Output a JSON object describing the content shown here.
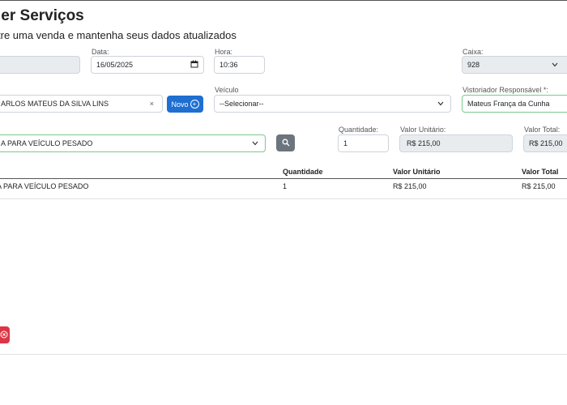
{
  "header": {
    "title": "ler Serviços",
    "subtitle": "tre uma venda e mantenha seus dados atualizados"
  },
  "form": {
    "data_label": "Data:",
    "data_value": "16/05/2025",
    "hora_label": "Hora:",
    "hora_value": "10:36",
    "caixa_label": "Caixa:",
    "caixa_value": "928",
    "cliente_value": "ARLOS MATEUS DA SILVA LINS",
    "novo_label": "Novo",
    "veiculo_label": "Veículo",
    "veiculo_value": "--Selecionar--",
    "vistoriador_label": "Vistoriador Responsável *:",
    "vistoriador_value": "Mateus França da Cunha",
    "servico_value": "A PARA VEÍCULO PESADO",
    "quantidade_label": "Quantidade:",
    "quantidade_value": "1",
    "valor_unitario_label": "Valor Unitário:",
    "valor_unitario_value": "R$ 215,00",
    "valor_total_label": "Valor Total:",
    "valor_total_value": "R$ 215,00"
  },
  "table": {
    "headers": [
      "Quantidade",
      "Valor Unitário",
      "Valor Total"
    ],
    "rows": [
      {
        "servico": "A PARA VEÍCULO PESADO",
        "quantidade": "1",
        "valor_unitario": "R$ 215,00",
        "valor_total": "R$ 215,00"
      }
    ]
  },
  "icons": {
    "search": "search-icon",
    "calendar": "calendar-icon",
    "chevron": "chevron-down-icon",
    "clear": "clear-icon",
    "plus_circle": "plus-circle-icon"
  },
  "colors": {
    "primary": "#1e6fd1",
    "secondary": "#6c757d",
    "danger": "#dc3545",
    "valid_border": "#7cc98e"
  }
}
